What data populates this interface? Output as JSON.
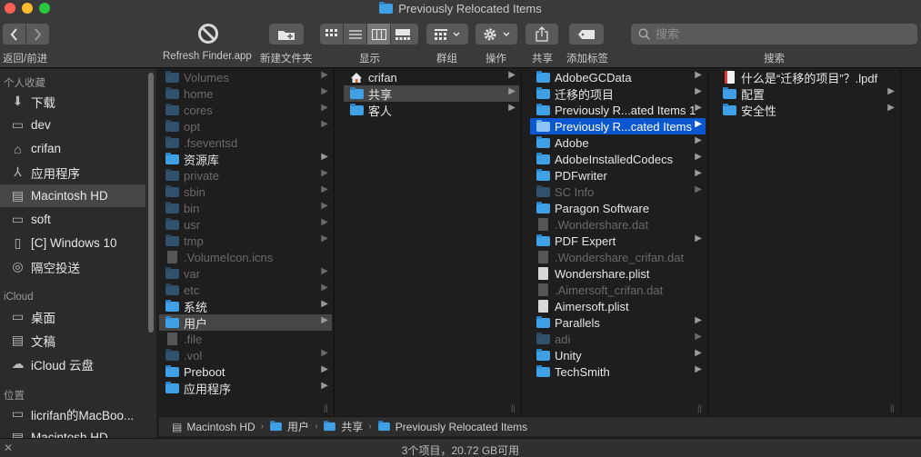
{
  "window": {
    "title": "Previously Relocated Items"
  },
  "toolbar": {
    "back_forward_label": "返回/前进",
    "refresh_label": "Refresh Finder.app",
    "new_folder_label": "新建文件夹",
    "view_label": "显示",
    "group_label": "群组",
    "action_label": "操作",
    "share_label": "共享",
    "tags_label": "添加标签",
    "search_label": "搜索",
    "search_placeholder": "搜索"
  },
  "sidebar": {
    "favorites_header": "个人收藏",
    "icloud_header": "iCloud",
    "locations_header": "位置",
    "favorites": [
      {
        "label": "下载",
        "icon": "download-icon"
      },
      {
        "label": "dev",
        "icon": "folder-icon"
      },
      {
        "label": "crifan",
        "icon": "home-icon"
      },
      {
        "label": "应用程序",
        "icon": "applications-icon"
      },
      {
        "label": "Macintosh HD",
        "icon": "hard-drive-icon",
        "selected": true
      },
      {
        "label": "soft",
        "icon": "folder-icon"
      },
      {
        "label": "[C] Windows 10",
        "icon": "document-icon"
      },
      {
        "label": "隔空投送",
        "icon": "airdrop-icon"
      }
    ],
    "icloud": [
      {
        "label": "桌面",
        "icon": "desktop-icon"
      },
      {
        "label": "文稿",
        "icon": "documents-icon"
      },
      {
        "label": "iCloud 云盘",
        "icon": "cloud-icon"
      }
    ],
    "locations": [
      {
        "label": "licrifan的MacBoo...",
        "icon": "laptop-icon"
      },
      {
        "label": "Macintosh HD",
        "icon": "hard-drive-icon"
      }
    ]
  },
  "columns": [
    [
      {
        "name": "Volumes",
        "kind": "folder",
        "dim": true,
        "arrow": true
      },
      {
        "name": "home",
        "kind": "folder",
        "dim": true,
        "arrow": true
      },
      {
        "name": "cores",
        "kind": "folder",
        "dim": true,
        "arrow": true
      },
      {
        "name": "opt",
        "kind": "folder",
        "dim": true,
        "arrow": true
      },
      {
        "name": ".fseventsd",
        "kind": "folder",
        "dim": true,
        "arrow": false
      },
      {
        "name": "资源库",
        "kind": "folder",
        "dim": false,
        "arrow": true
      },
      {
        "name": "private",
        "kind": "folder",
        "dim": true,
        "arrow": true
      },
      {
        "name": "sbin",
        "kind": "folder",
        "dim": true,
        "arrow": true
      },
      {
        "name": "bin",
        "kind": "folder",
        "dim": true,
        "arrow": true
      },
      {
        "name": "usr",
        "kind": "folder",
        "dim": true,
        "arrow": true
      },
      {
        "name": "tmp",
        "kind": "folder",
        "dim": true,
        "arrow": true
      },
      {
        "name": ".VolumeIcon.icns",
        "kind": "file",
        "dim": true,
        "arrow": false
      },
      {
        "name": "var",
        "kind": "folder",
        "dim": true,
        "arrow": true
      },
      {
        "name": "etc",
        "kind": "folder",
        "dim": true,
        "arrow": true
      },
      {
        "name": "系统",
        "kind": "folder",
        "dim": false,
        "arrow": true
      },
      {
        "name": "用户",
        "kind": "folder",
        "dim": false,
        "arrow": true,
        "selected": "grey"
      },
      {
        "name": ".file",
        "kind": "file",
        "dim": true,
        "arrow": false
      },
      {
        "name": ".vol",
        "kind": "folder",
        "dim": true,
        "arrow": true
      },
      {
        "name": "Preboot",
        "kind": "folder",
        "dim": false,
        "arrow": true
      },
      {
        "name": "应用程序",
        "kind": "folder",
        "dim": false,
        "arrow": true
      }
    ],
    [
      {
        "name": "crifan",
        "kind": "home",
        "dim": false,
        "arrow": true
      },
      {
        "name": "共享",
        "kind": "folder",
        "dim": false,
        "arrow": true,
        "selected": "grey"
      },
      {
        "name": "客人",
        "kind": "folder",
        "dim": false,
        "arrow": true
      }
    ],
    [
      {
        "name": "AdobeGCData",
        "kind": "folder",
        "dim": false,
        "arrow": true
      },
      {
        "name": "迁移的项目",
        "kind": "folder",
        "dim": false,
        "arrow": true
      },
      {
        "name": "Previously R...ated Items 1",
        "kind": "folder",
        "dim": false,
        "arrow": true
      },
      {
        "name": "Previously R...cated Items",
        "kind": "folder",
        "dim": false,
        "arrow": true,
        "selected": "blue"
      },
      {
        "name": "Adobe",
        "kind": "folder",
        "dim": false,
        "arrow": true
      },
      {
        "name": "AdobeInstalledCodecs",
        "kind": "folder",
        "dim": false,
        "arrow": true
      },
      {
        "name": "PDFwriter",
        "kind": "folder",
        "dim": false,
        "arrow": true
      },
      {
        "name": "SC Info",
        "kind": "folder",
        "dim": true,
        "arrow": true
      },
      {
        "name": "Paragon Software",
        "kind": "folder",
        "dim": false,
        "arrow": false
      },
      {
        "name": ".Wondershare.dat",
        "kind": "file",
        "dim": true,
        "arrow": false
      },
      {
        "name": "PDF Expert",
        "kind": "folder",
        "dim": false,
        "arrow": true
      },
      {
        "name": ".Wondershare_crifan.dat",
        "kind": "file",
        "dim": true,
        "arrow": false
      },
      {
        "name": "Wondershare.plist",
        "kind": "file",
        "dim": false,
        "arrow": false
      },
      {
        "name": ".Aimersoft_crifan.dat",
        "kind": "file",
        "dim": true,
        "arrow": false
      },
      {
        "name": "Aimersoft.plist",
        "kind": "file",
        "dim": false,
        "arrow": false
      },
      {
        "name": "Parallels",
        "kind": "folder",
        "dim": false,
        "arrow": true
      },
      {
        "name": "adi",
        "kind": "folder",
        "dim": true,
        "arrow": true
      },
      {
        "name": "Unity",
        "kind": "folder",
        "dim": false,
        "arrow": true
      },
      {
        "name": "TechSmith",
        "kind": "folder",
        "dim": false,
        "arrow": true
      }
    ],
    [
      {
        "name": "什么是“迁移的项目”？.lpdf",
        "kind": "pdf",
        "dim": false,
        "arrow": false
      },
      {
        "name": "配置",
        "kind": "folder",
        "dim": false,
        "arrow": true
      },
      {
        "name": "安全性",
        "kind": "folder",
        "dim": false,
        "arrow": true
      }
    ]
  ],
  "pathbar": [
    {
      "label": "Macintosh HD",
      "icon": "hard-drive-icon"
    },
    {
      "label": "用户",
      "icon": "folder-icon"
    },
    {
      "label": "共享",
      "icon": "folder-icon"
    },
    {
      "label": "Previously Relocated Items",
      "icon": "folder-icon"
    }
  ],
  "status": {
    "text": "3个项目，20.72 GB可用"
  }
}
